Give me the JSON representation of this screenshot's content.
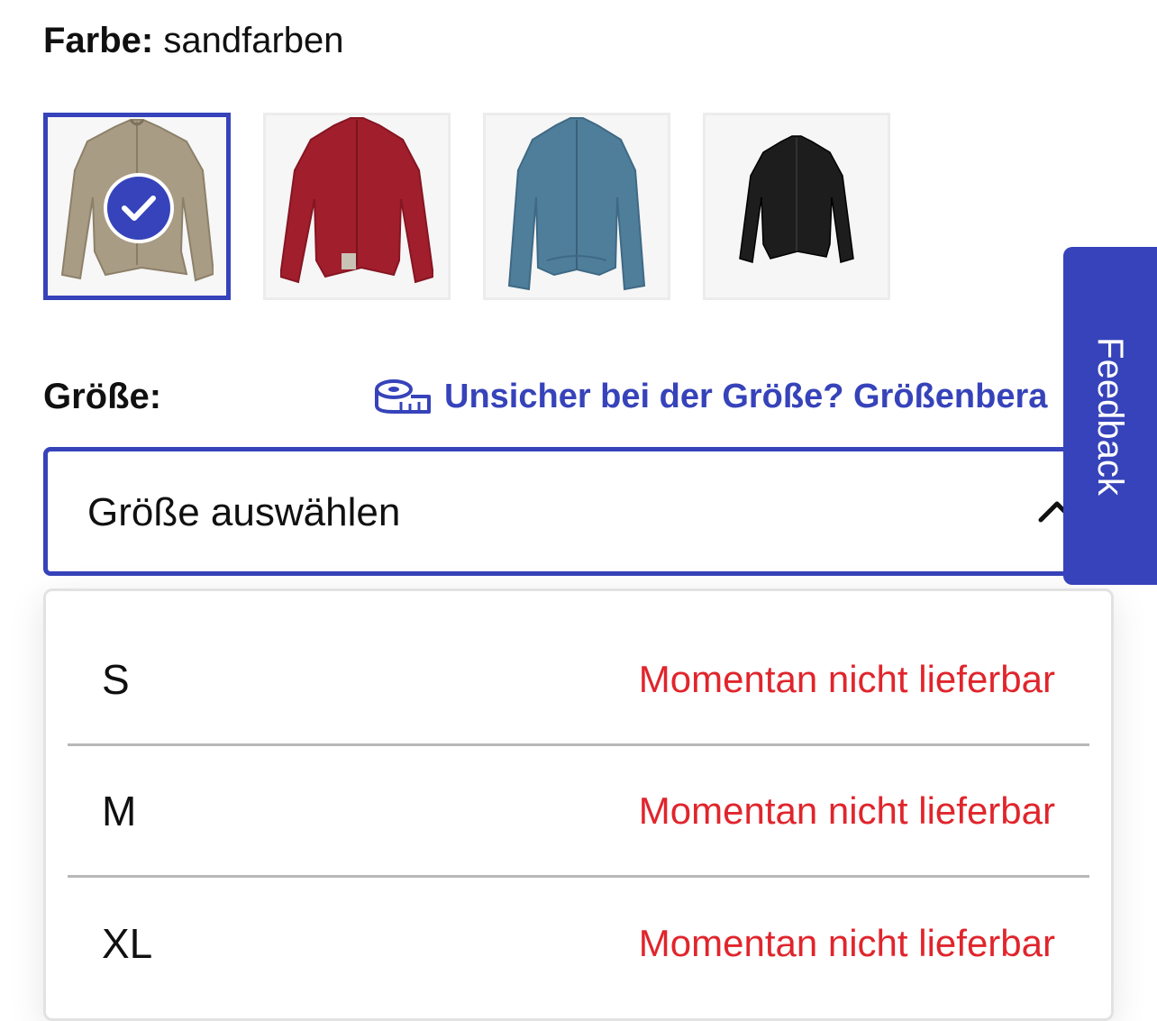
{
  "color": {
    "label": "Farbe:",
    "value": "sandfarben",
    "selected_index": 0,
    "swatches": [
      {
        "name": "sand",
        "color": "#a99c84"
      },
      {
        "name": "red",
        "color": "#a11e2c"
      },
      {
        "name": "blue",
        "color": "#4f7e9b"
      },
      {
        "name": "black",
        "color": "#1d1d1d"
      }
    ]
  },
  "size": {
    "label": "Größe:",
    "guide_text": "Unsicher bei der Größe? Größenbera",
    "select_placeholder": "Größe auswählen",
    "options": [
      {
        "size": "S",
        "status": "Momentan nicht lieferbar"
      },
      {
        "size": "M",
        "status": "Momentan nicht lieferbar"
      },
      {
        "size": "XL",
        "status": "Momentan nicht lieferbar"
      }
    ]
  },
  "feedback": {
    "label": "Feedback"
  },
  "theme": {
    "accent": "#3643ba",
    "unavailable": "#e0252c"
  }
}
